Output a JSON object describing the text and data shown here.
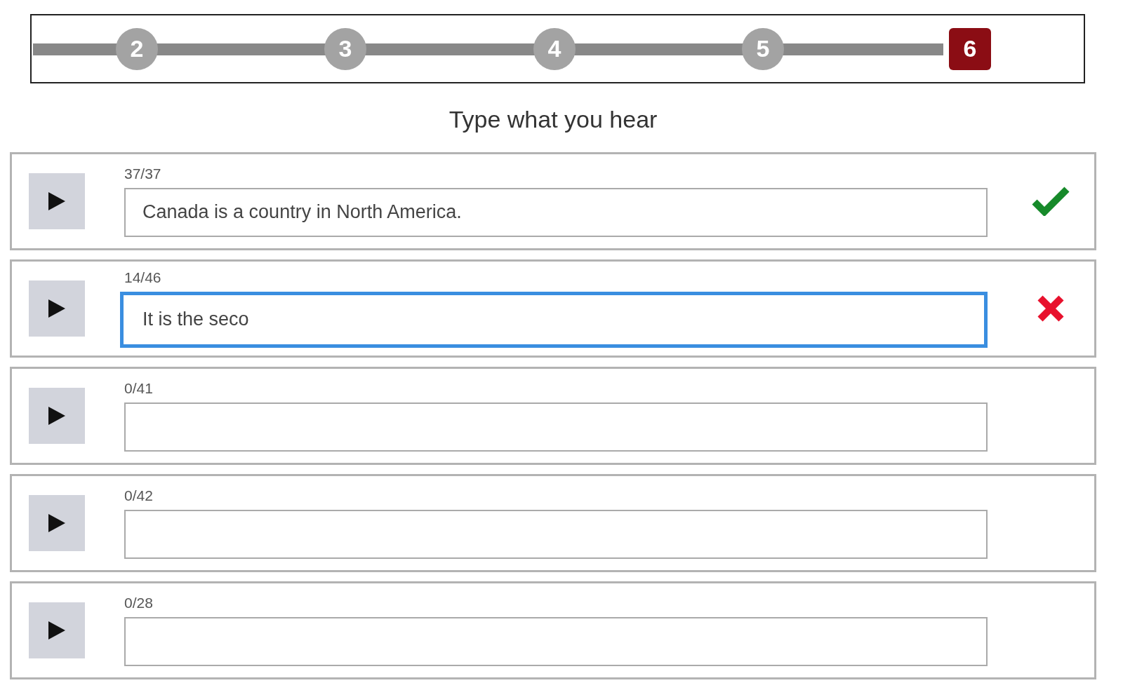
{
  "steps": [
    {
      "label": "2",
      "selected": false
    },
    {
      "label": "3",
      "selected": false
    },
    {
      "label": "4",
      "selected": false
    },
    {
      "label": "5",
      "selected": false
    },
    {
      "label": "6",
      "selected": true
    }
  ],
  "title": "Type what you hear",
  "items": [
    {
      "counter": "37/37",
      "value": "Canada is a country in North America.",
      "focused": false,
      "kind": "correct"
    },
    {
      "counter": "14/46",
      "value": "It is the seco",
      "focused": true,
      "kind": "wrong"
    },
    {
      "counter": "0/41",
      "value": "",
      "focused": false,
      "kind": "blank"
    },
    {
      "counter": "0/42",
      "value": "",
      "focused": false,
      "kind": "blank"
    },
    {
      "counter": "0/28",
      "value": "",
      "focused": false,
      "kind": "blank"
    }
  ]
}
